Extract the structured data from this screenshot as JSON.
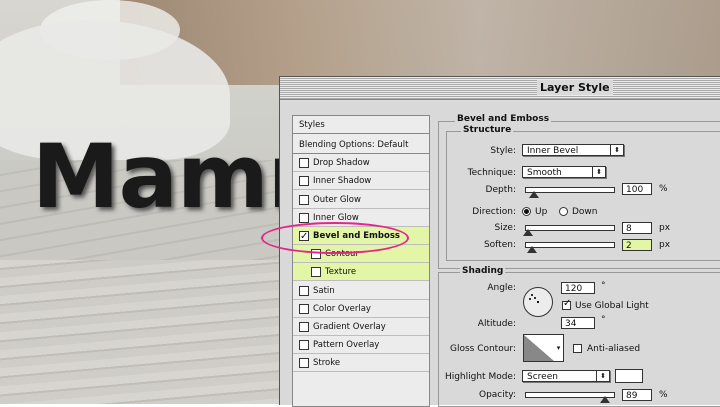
{
  "background": {
    "word": "Mamn"
  },
  "dialog": {
    "title": "Layer Style"
  },
  "styles_pane": {
    "header": "Styles",
    "items": [
      {
        "label": "Blending Options: Default",
        "checkbox": false,
        "checked": false,
        "selected": false,
        "sub": false
      },
      {
        "label": "Drop Shadow",
        "checkbox": true,
        "checked": false,
        "selected": false,
        "sub": false
      },
      {
        "label": "Inner Shadow",
        "checkbox": true,
        "checked": false,
        "selected": false,
        "sub": false
      },
      {
        "label": "Outer Glow",
        "checkbox": true,
        "checked": false,
        "selected": false,
        "sub": false
      },
      {
        "label": "Inner Glow",
        "checkbox": true,
        "checked": false,
        "selected": false,
        "sub": false
      },
      {
        "label": "Bevel and Emboss",
        "checkbox": true,
        "checked": true,
        "selected": true,
        "sub": false
      },
      {
        "label": "Contour",
        "checkbox": true,
        "checked": false,
        "selected": false,
        "sub": true
      },
      {
        "label": "Texture",
        "checkbox": true,
        "checked": false,
        "selected": false,
        "sub": true
      },
      {
        "label": "Satin",
        "checkbox": true,
        "checked": false,
        "selected": false,
        "sub": false
      },
      {
        "label": "Color Overlay",
        "checkbox": true,
        "checked": false,
        "selected": false,
        "sub": false
      },
      {
        "label": "Gradient Overlay",
        "checkbox": true,
        "checked": false,
        "selected": false,
        "sub": false
      },
      {
        "label": "Pattern Overlay",
        "checkbox": true,
        "checked": false,
        "selected": false,
        "sub": false
      },
      {
        "label": "Stroke",
        "checkbox": true,
        "checked": false,
        "selected": false,
        "sub": false
      }
    ]
  },
  "bevel": {
    "section_title": "Bevel and Emboss",
    "structure_title": "Structure",
    "style_label": "Style:",
    "style_value": "Inner Bevel",
    "technique_label": "Technique:",
    "technique_value": "Smooth",
    "depth_label": "Depth:",
    "depth_value": "100",
    "depth_unit": "%",
    "direction_label": "Direction:",
    "direction_up": "Up",
    "direction_down": "Down",
    "direction_selected": "Up",
    "size_label": "Size:",
    "size_value": "8",
    "size_unit": "px",
    "soften_label": "Soften:",
    "soften_value": "2",
    "soften_unit": "px"
  },
  "shading": {
    "title": "Shading",
    "angle_label": "Angle:",
    "angle_value": "120",
    "angle_unit": "°",
    "global_light_label": "Use Global Light",
    "global_light_checked": true,
    "altitude_label": "Altitude:",
    "altitude_value": "34",
    "altitude_unit": "°",
    "gloss_contour_label": "Gloss Contour:",
    "anti_aliased_label": "Anti-aliased",
    "anti_aliased_checked": false,
    "highlight_mode_label": "Highlight Mode:",
    "highlight_mode_value": "Screen",
    "highlight_color": "#ffffff",
    "opacity_label": "Opacity:",
    "opacity_value": "89",
    "opacity_unit": "%"
  },
  "colors": {
    "selection": "#e3f5a6",
    "annotation": "#e2268a"
  }
}
